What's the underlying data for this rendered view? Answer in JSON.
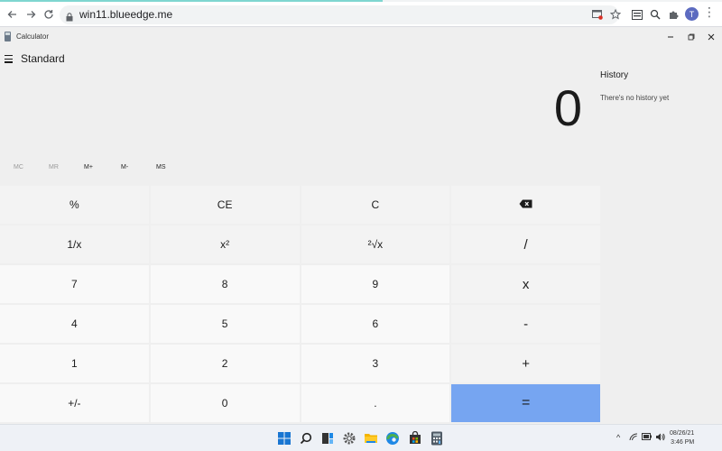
{
  "browser": {
    "url": "win11.blueedge.me",
    "loading_progress": 0.53,
    "profile_initial": "T"
  },
  "window": {
    "title": "Calculator"
  },
  "calculator": {
    "mode": "Standard",
    "display_value": "0",
    "memory": [
      "MC",
      "MR",
      "M+",
      "M-",
      "MS"
    ],
    "keys": [
      [
        "%",
        "CE",
        "C",
        "backspace-icon"
      ],
      [
        "1/x",
        "x²",
        "²√x",
        "/"
      ],
      [
        "7",
        "8",
        "9",
        "x"
      ],
      [
        "4",
        "5",
        "6",
        "-"
      ],
      [
        "1",
        "2",
        "3",
        "+"
      ],
      [
        "+/-",
        "0",
        ".",
        "="
      ]
    ],
    "equals_color": "#76a5f1"
  },
  "history": {
    "title": "History",
    "empty_text": "There's no history yet"
  },
  "taskbar": {
    "apps": [
      "windows-icon",
      "search-icon",
      "task-view-icon",
      "settings-icon",
      "file-explorer-icon",
      "edge-icon",
      "store-icon",
      "calculator-icon"
    ],
    "date": "08/26/21",
    "time": "3:46 PM"
  }
}
